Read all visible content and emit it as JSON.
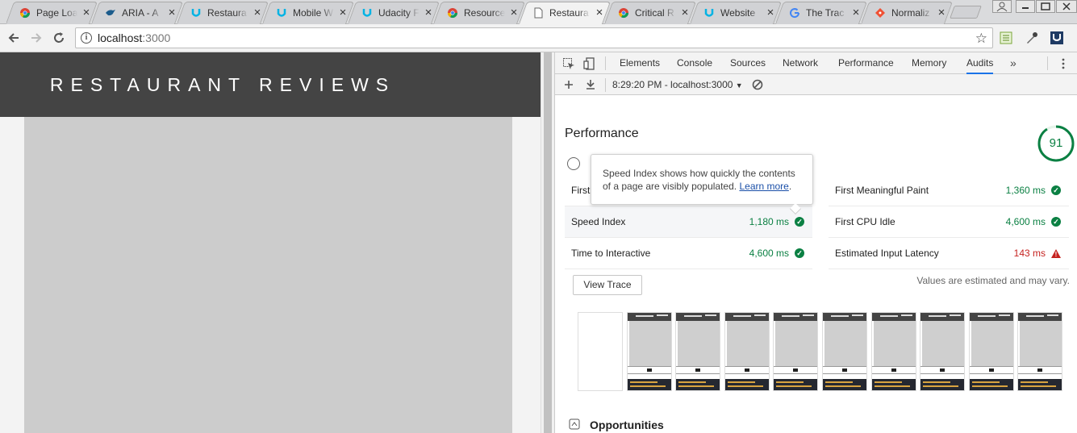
{
  "browser": {
    "tabs": [
      {
        "title": "Page Loa",
        "icon": "chrome-icon",
        "active": false
      },
      {
        "title": "ARIA - A",
        "icon": "bird-icon",
        "active": false
      },
      {
        "title": "Restaura",
        "icon": "udacity-icon",
        "active": false
      },
      {
        "title": "Mobile W",
        "icon": "udacity-icon",
        "active": false
      },
      {
        "title": "Udacity F",
        "icon": "udacity-icon",
        "active": false
      },
      {
        "title": "Resource",
        "icon": "chrome-icon",
        "active": false
      },
      {
        "title": "Restaura",
        "icon": "page-icon",
        "active": true
      },
      {
        "title": "Critical R",
        "icon": "chrome-icon",
        "active": false
      },
      {
        "title": "Website",
        "icon": "udacity-icon",
        "active": false
      },
      {
        "title": "The Trac",
        "icon": "google-icon",
        "active": false
      },
      {
        "title": "Normaliz",
        "icon": "diamond-icon",
        "active": false
      }
    ],
    "close_glyph": "×",
    "url_host": "localhost",
    "url_port": ":3000"
  },
  "page": {
    "site_title": "RESTAURANT REVIEWS"
  },
  "devtools": {
    "tabs": [
      "Elements",
      "Console",
      "Sources",
      "Network",
      "Performance",
      "Memory",
      "Audits"
    ],
    "active_tab": "Audits",
    "more_glyph": "»",
    "audit_selector": "8:29:20 PM - localhost:3000",
    "report": {
      "section_title": "Performance",
      "score": "91",
      "score_color": "#0b8043",
      "metrics_left": [
        {
          "label": "First",
          "value": "",
          "status": ""
        },
        {
          "label": "Speed Index",
          "value": "1,180 ms",
          "status": "pass"
        },
        {
          "label": "Time to Interactive",
          "value": "4,600 ms",
          "status": "pass"
        }
      ],
      "metrics_right": [
        {
          "label": "First Meaningful Paint",
          "value": "1,360 ms",
          "status": "pass"
        },
        {
          "label": "First CPU Idle",
          "value": "4,600 ms",
          "status": "pass"
        },
        {
          "label": "Estimated Input Latency",
          "value": "143 ms",
          "status": "warn"
        }
      ],
      "tooltip_text": "Speed Index shows how quickly the contents of a page are visibly populated.",
      "tooltip_link": "Learn more",
      "tooltip_end": ".",
      "view_trace_label": "View Trace",
      "estimate_note": "Values are estimated and may vary.",
      "filmstrip_frames": 10,
      "opportunities_title": "Opportunities"
    }
  }
}
